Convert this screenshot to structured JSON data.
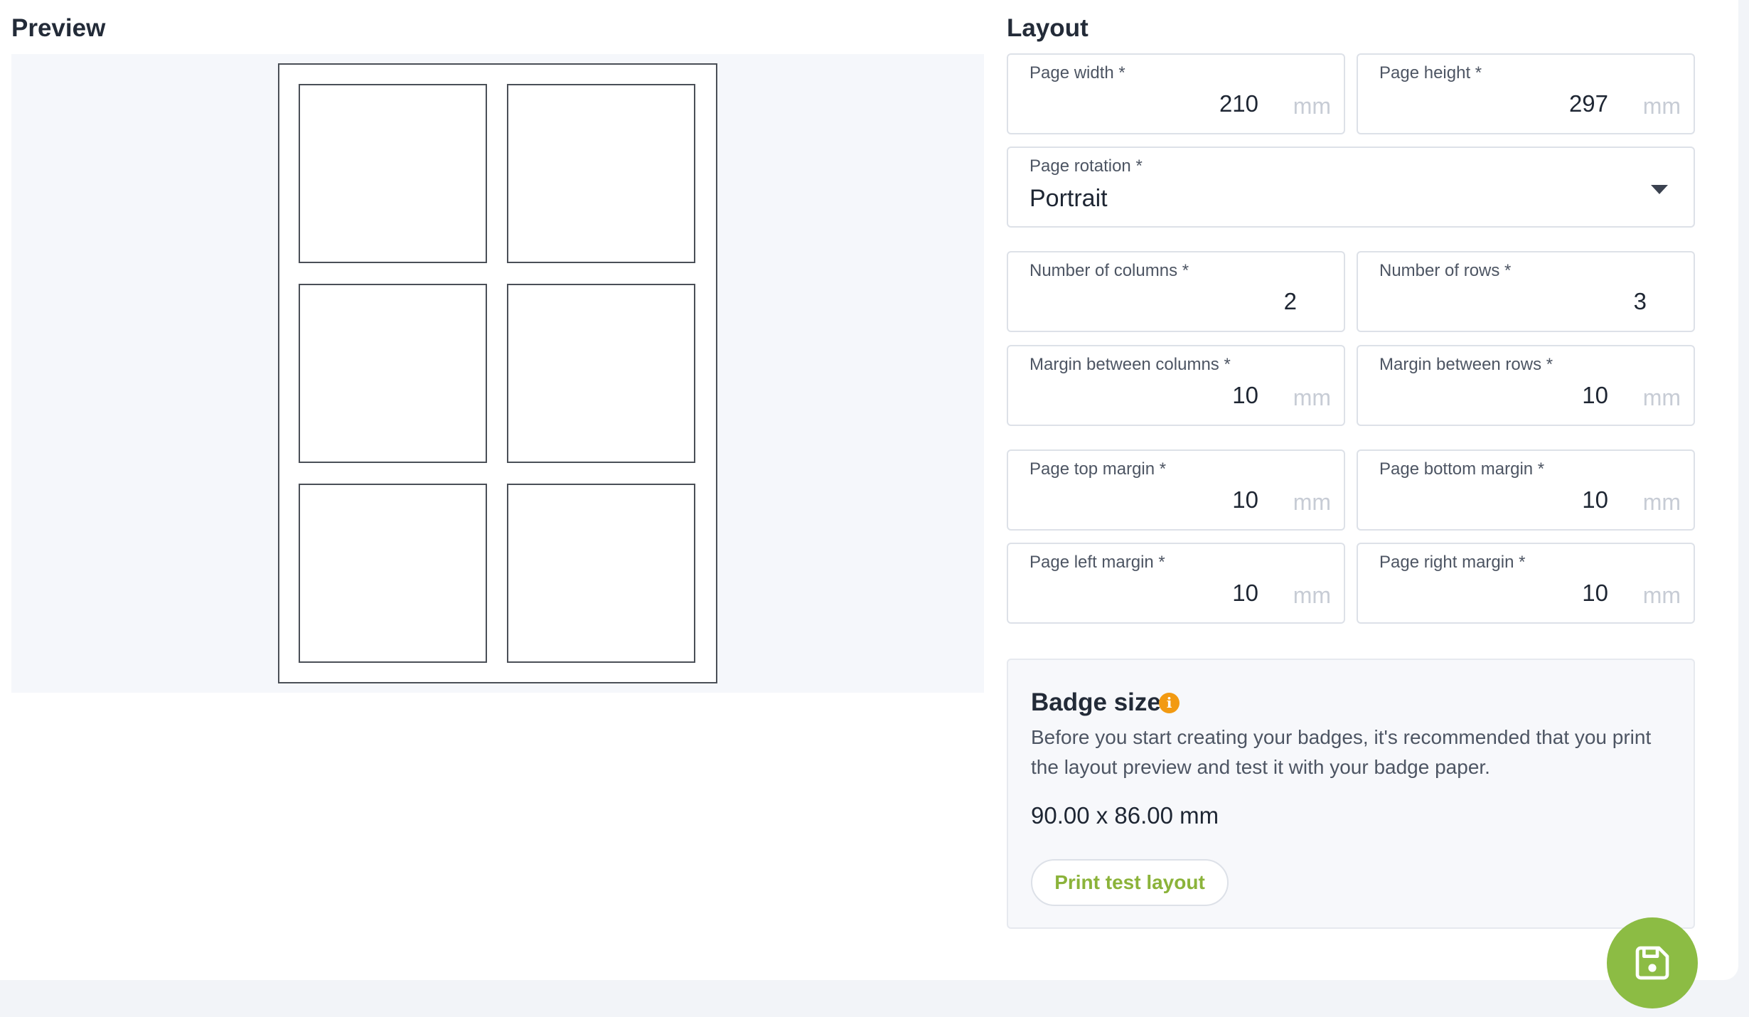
{
  "preview": {
    "title": "Preview"
  },
  "layout": {
    "title": "Layout",
    "page_width": {
      "label": "Page width *",
      "value": "210",
      "unit": "mm"
    },
    "page_height": {
      "label": "Page height *",
      "value": "297",
      "unit": "mm"
    },
    "page_rotation": {
      "label": "Page rotation *",
      "value": "Portrait"
    },
    "columns": {
      "label": "Number of columns *",
      "value": "2"
    },
    "rows": {
      "label": "Number of rows *",
      "value": "3"
    },
    "margin_columns": {
      "label": "Margin between columns *",
      "value": "10",
      "unit": "mm"
    },
    "margin_rows": {
      "label": "Margin between rows *",
      "value": "10",
      "unit": "mm"
    },
    "margin_top": {
      "label": "Page top margin *",
      "value": "10",
      "unit": "mm"
    },
    "margin_bottom": {
      "label": "Page bottom margin *",
      "value": "10",
      "unit": "mm"
    },
    "margin_left": {
      "label": "Page left margin *",
      "value": "10",
      "unit": "mm"
    },
    "margin_right": {
      "label": "Page right margin *",
      "value": "10",
      "unit": "mm"
    }
  },
  "badge_size": {
    "title": "Badge size",
    "info_icon": "i",
    "description": "Before you start creating your badges, it's recommended that you print the layout preview and test it with your badge paper.",
    "dimensions": "90.00 x 86.00 mm",
    "print_button": "Print test layout"
  },
  "icons": {
    "info": "info-icon",
    "save": "floppy-disk-icon",
    "dropdown": "caret-down-icon"
  },
  "colors": {
    "accent_green": "#8cbc44",
    "print_text": "#8bb33a",
    "info_orange": "#f29a12"
  }
}
